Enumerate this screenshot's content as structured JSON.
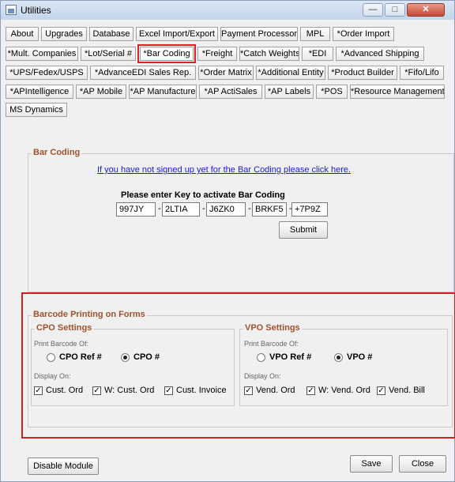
{
  "window": {
    "title": "Utilities"
  },
  "tabs": [
    {
      "label": "About"
    },
    {
      "label": "Upgrades"
    },
    {
      "label": "Database"
    },
    {
      "label": "Excel Import/Export"
    },
    {
      "label": "Payment Processor"
    },
    {
      "label": "MPL"
    },
    {
      "label": "*Order Import"
    },
    {
      "label": "*Mult. Companies"
    },
    {
      "label": "*Lot/Serial #"
    },
    {
      "label": "*Bar Coding"
    },
    {
      "label": "*Freight"
    },
    {
      "label": "*Catch Weights"
    },
    {
      "label": "*EDI"
    },
    {
      "label": "*Advanced Shipping"
    },
    {
      "label": "*UPS/Fedex/USPS"
    },
    {
      "label": "*AdvanceEDI Sales Rep."
    },
    {
      "label": "*Order Matrix"
    },
    {
      "label": "*Additional Entity"
    },
    {
      "label": "*Product Builder"
    },
    {
      "label": "*Fifo/Lifo"
    },
    {
      "label": "*APIntelligence"
    },
    {
      "label": "*AP Mobile"
    },
    {
      "label": "*AP Manufacture"
    },
    {
      "label": "*AP ActiSales"
    },
    {
      "label": "*AP Labels"
    },
    {
      "label": "*POS"
    },
    {
      "label": "*Resource Management"
    },
    {
      "label": "MS Dynamics"
    }
  ],
  "bar_coding": {
    "group_title": "Bar Coding",
    "signup_link": "If you have not signed up yet for the Bar Coding  please click here.",
    "key_label": "Please enter Key  to activate Bar Coding",
    "key_parts": [
      "997JY",
      "2LTIA",
      "J6ZK0",
      "BRKF5",
      "+7P9Z"
    ],
    "submit_label": "Submit"
  },
  "barcode_printing": {
    "group_title": "Barcode Printing on Forms",
    "cpo": {
      "title": "CPO Settings",
      "print_label": "Print Barcode Of:",
      "radio_ref": "CPO Ref #",
      "radio_num": "CPO #",
      "display_label": "Display On:",
      "cb1": "Cust. Ord",
      "cb2": "W: Cust. Ord",
      "cb3": "Cust. Invoice"
    },
    "vpo": {
      "title": "VPO Settings",
      "print_label": "Print Barcode Of:",
      "radio_ref": "VPO Ref #",
      "radio_num": "VPO #",
      "display_label": "Display On:",
      "cb1": "Vend. Ord",
      "cb2": "W: Vend. Ord",
      "cb3": "Vend. Bill"
    }
  },
  "footer": {
    "disable_label": "Disable Module",
    "save_label": "Save",
    "close_label": "Close"
  },
  "accent_colors": {
    "highlight": "#e02020",
    "group_title": "#a0522d",
    "link": "#1a1adf"
  }
}
